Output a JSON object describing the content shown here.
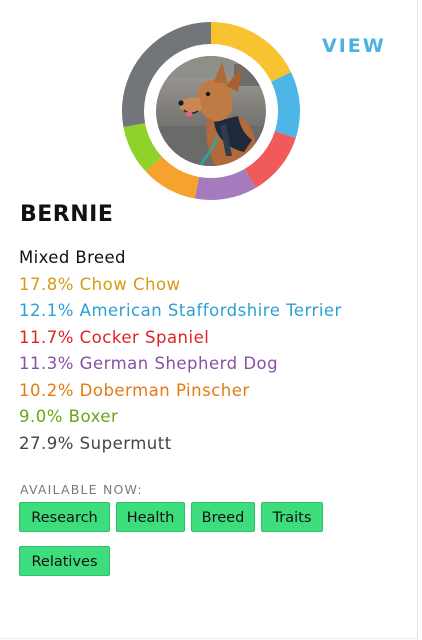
{
  "header": {
    "view_label": "VIEW"
  },
  "dog": {
    "name": "BERNIE",
    "mix_label": "Mixed Breed"
  },
  "breeds": [
    {
      "text": "17.8% Chow Chow",
      "percent": 17.8,
      "color": "#f7c331"
    },
    {
      "text": "12.1% American Staffordshire Terrier",
      "percent": 12.1,
      "color": "#4db6e7"
    },
    {
      "text": "11.7% Cocker Spaniel",
      "percent": 11.7,
      "color": "#f05a5a"
    },
    {
      "text": "11.3% German Shepherd Dog",
      "percent": 11.3,
      "color": "#a57bbd"
    },
    {
      "text": "10.2% Doberman Pinscher",
      "percent": 10.2,
      "color": "#f7a12e"
    },
    {
      "text": "9.0% Boxer",
      "percent": 9.0,
      "color": "#8fd22a"
    },
    {
      "text": "27.9% Supermutt",
      "percent": 27.9,
      "color": "#72757a"
    }
  ],
  "text_colors": {
    "chow": "#d89a12",
    "staff": "#2c9fd6",
    "cocker": "#e12222",
    "shepherd": "#8a4fa6",
    "doberman": "#e27b14",
    "boxer": "#6ea316",
    "supermutt": "#444444"
  },
  "available": {
    "label": "AVAILABLE NOW:",
    "tags": [
      "Research",
      "Health",
      "Breed",
      "Traits",
      "Relatives"
    ]
  }
}
